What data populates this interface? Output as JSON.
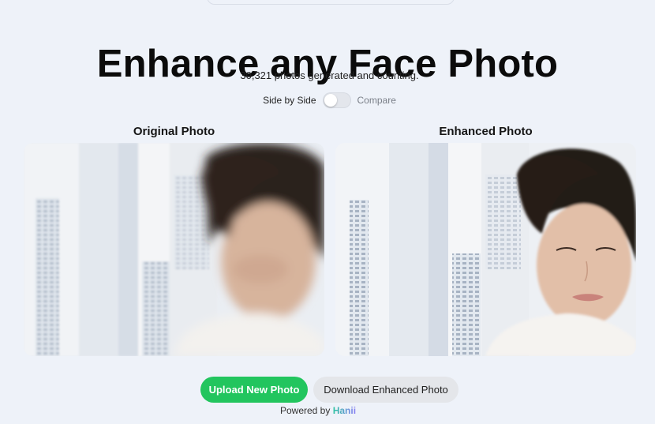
{
  "header": {
    "title": "Enhance any Face Photo",
    "subtitle": "30,321 photos generated and counting."
  },
  "view_toggle": {
    "left_label": "Side by Side",
    "right_label": "Compare",
    "state": "side-by-side"
  },
  "panels": {
    "original_label": "Original Photo",
    "enhanced_label": "Enhanced Photo"
  },
  "actions": {
    "upload_label": "Upload New Photo",
    "download_label": "Download Enhanced Photo"
  },
  "footer": {
    "powered_prefix": "Powered by",
    "brand": "Hanii"
  },
  "colors": {
    "page_bg": "#eef2f9",
    "upload_button": "#22c55e",
    "download_button": "#e4e6ea",
    "brand_gradient_start": "#2cc3a0",
    "brand_gradient_end": "#8b7cf6"
  }
}
